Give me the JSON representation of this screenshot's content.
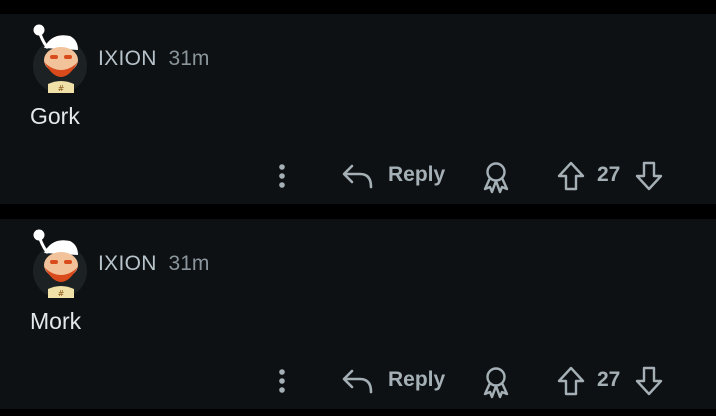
{
  "comments": [
    {
      "author": "IXION",
      "time_ago": "31m",
      "body": "Gork",
      "actions": {
        "more_icon": "more-vertical-icon",
        "reply_icon": "reply-arrow-icon",
        "reply_label": "Reply",
        "award_icon": "award-icon",
        "upvote_icon": "arrow-up-icon",
        "score": "27",
        "downvote_icon": "arrow-down-icon"
      }
    },
    {
      "author": "IXION",
      "time_ago": "31m",
      "body": "Mork",
      "actions": {
        "more_icon": "more-vertical-icon",
        "reply_icon": "reply-arrow-icon",
        "reply_label": "Reply",
        "award_icon": "award-icon",
        "upvote_icon": "arrow-up-icon",
        "score": "27",
        "downvote_icon": "arrow-down-icon"
      }
    }
  ],
  "colors": {
    "page_background": "#000000",
    "card_background": "#0e1113",
    "username": "#b7c3ca",
    "timestamp": "#8a969c",
    "body_text": "#e3e8ea",
    "action_text": "#a4b0b6",
    "avatar_orange": "#d94a1c"
  }
}
